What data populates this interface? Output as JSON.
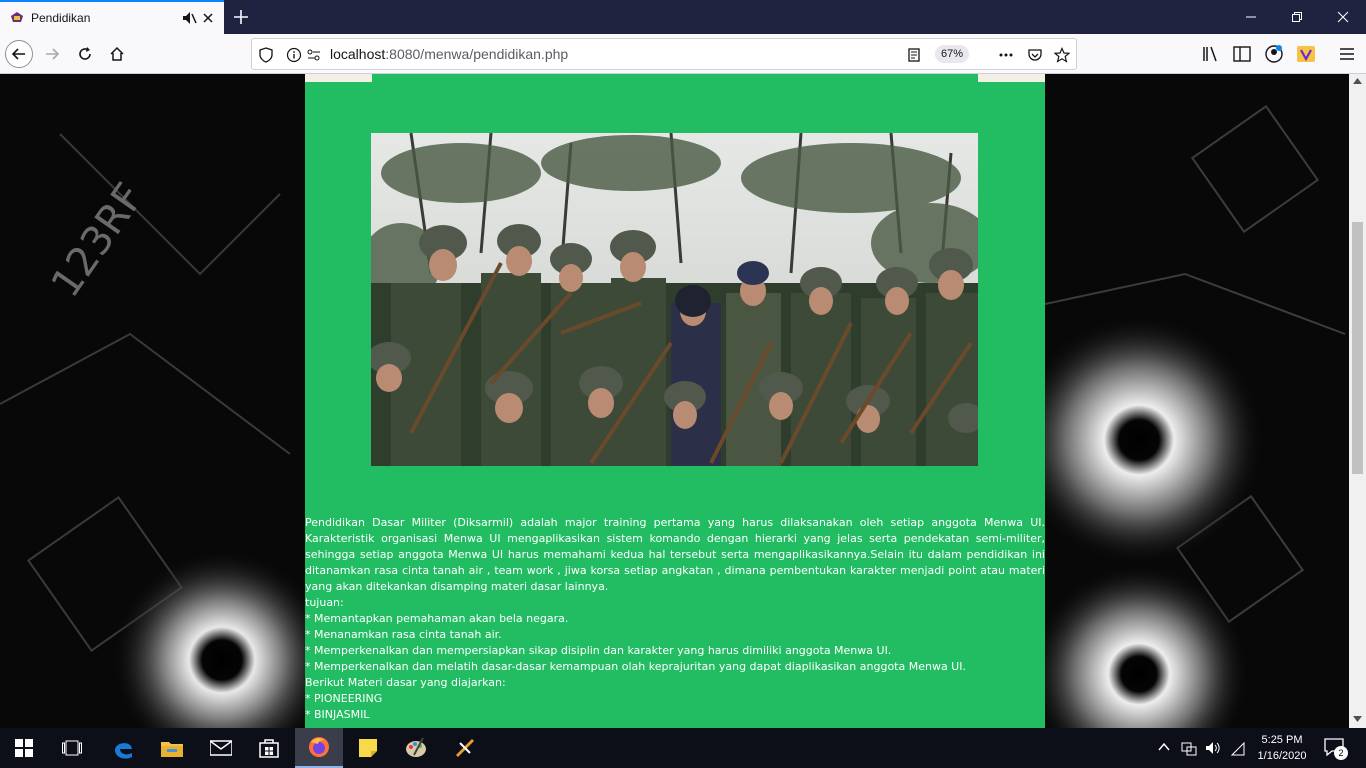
{
  "browser": {
    "tab": {
      "title": "Pendidikan"
    },
    "url": {
      "host": "localhost",
      "rest": ":8080/menwa/pendidikan.php"
    },
    "zoom": "67%"
  },
  "colors": {
    "panel": "#22bd62",
    "tabbar": "#202340",
    "accent": "#0a84ff",
    "taskbar": "#0c0e18"
  },
  "icons": {
    "tab": [
      "favicon-icon",
      "mute-icon",
      "close-icon",
      "plus-icon"
    ],
    "window": [
      "minimize-icon",
      "restore-icon",
      "close-window-icon"
    ],
    "nav": [
      "back-arrow-icon",
      "forward-arrow-icon",
      "reload-icon",
      "home-icon"
    ],
    "urlbar": [
      "shield-icon",
      "info-icon",
      "permissions-icon",
      "reader-mode-icon",
      "ellipsis-icon",
      "pocket-icon",
      "star-icon"
    ],
    "toolbar": [
      "library-icon",
      "sidebar-icon",
      "account-icon",
      "extension-icon",
      "menu-icon"
    ],
    "taskbar": [
      "windows-start-icon",
      "task-view-icon",
      "edge-icon",
      "file-explorer-icon",
      "mail-icon",
      "store-icon",
      "firefox-icon",
      "sticky-notes-icon",
      "paint-icon",
      "app-icon"
    ],
    "tray": [
      "chevron-up-icon",
      "network-icon",
      "volume-icon",
      "wifi-icon",
      "notification-icon"
    ]
  },
  "article": {
    "intro": "Pendidikan Dasar Militer (Diksarmil) adalah major training pertama yang harus dilaksanakan oleh setiap anggota Menwa UI. Karakteristik organisasi Menwa UI mengaplikasikan sistem komando dengan hierarki yang jelas serta pendekatan semi-militer, sehingga setiap anggota Menwa UI harus memahami kedua hal tersebut serta mengaplikasikannya.Selain itu dalam pendidikan ini ditanamkan rasa cinta tanah air , team work , jiwa korsa setiap angkatan , dimana pembentukan karakter menjadi point atau materi yang akan ditekankan disamping materi dasar lainnya.",
    "tujuan_label": "tujuan:",
    "tujuan": [
      "* Memantapkan pemahaman akan bela negara.",
      "* Menanamkan rasa cinta tanah air.",
      "* Memperkenalkan dan mempersiapkan sikap disiplin dan karakter yang harus dimiliki anggota Menwa UI.",
      "* Memperkenalkan dan melatih dasar-dasar kemampuan olah keprajuritan yang dapat diaplikasikan anggota Menwa UI."
    ],
    "materi_label": "Berikut Materi dasar yang diajarkan:",
    "materi": [
      "* PIONEERING",
      "* BINJASMIL"
    ]
  },
  "taskbar": {
    "time": "5:25 PM",
    "date": "1/16/2020",
    "notification_count": "2"
  }
}
